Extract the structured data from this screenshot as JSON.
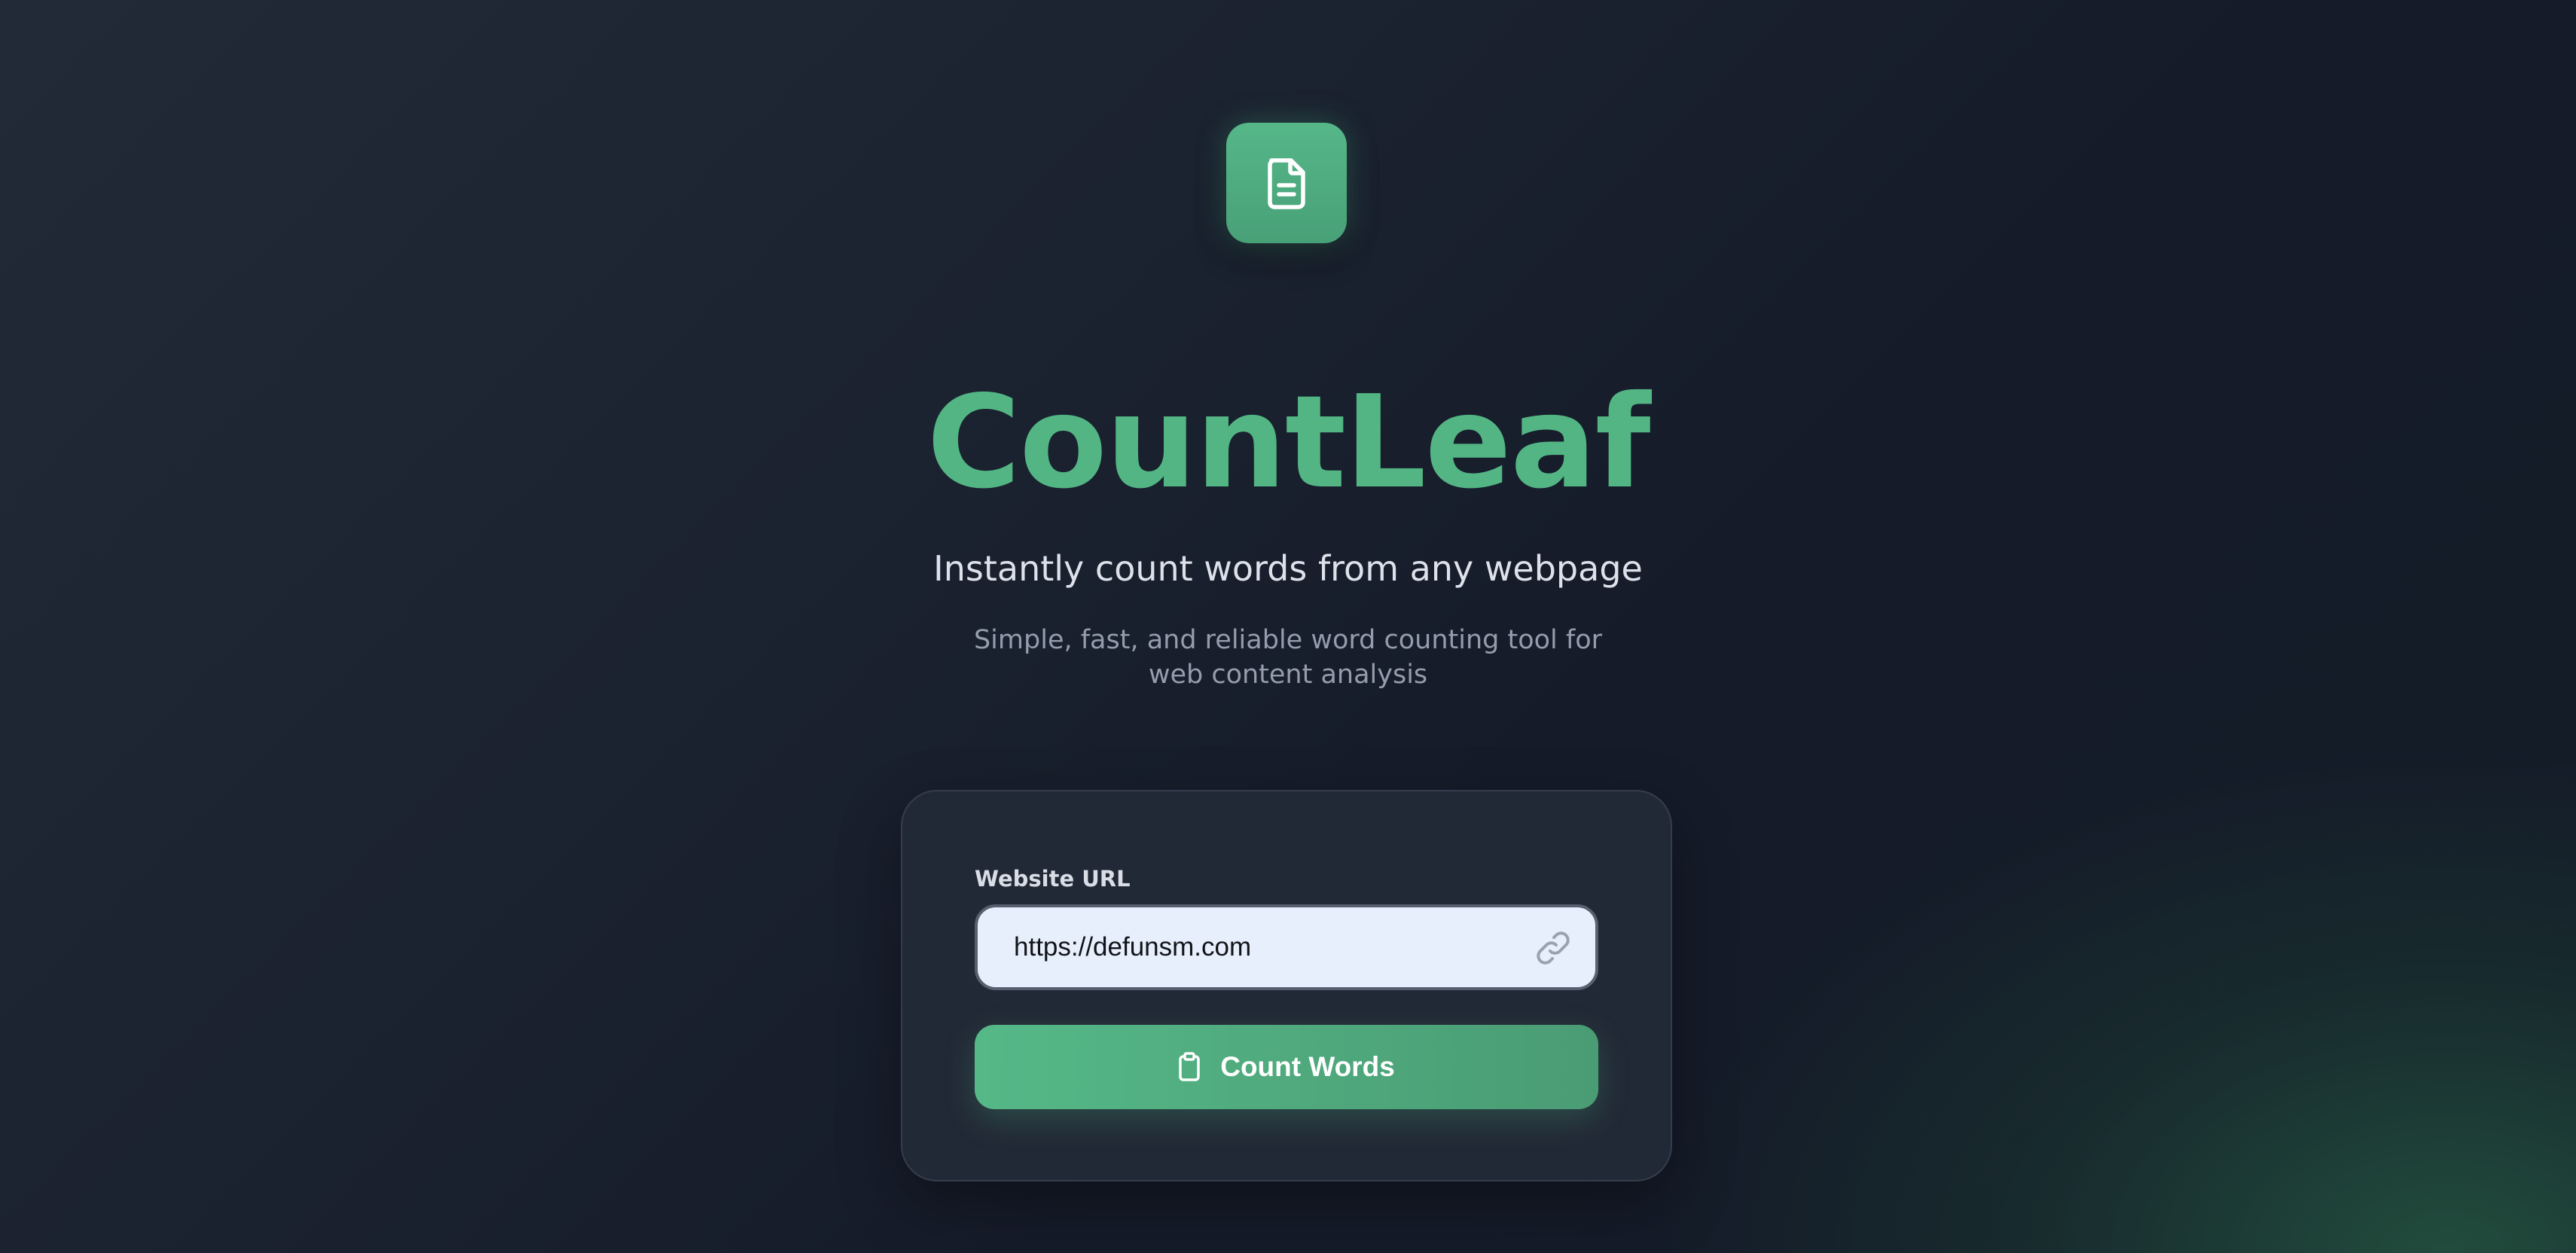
{
  "app": {
    "logo_icon": "document-icon",
    "title": "CountLeaf",
    "tagline": "Instantly count words from any webpage",
    "description": "Simple, fast, and reliable word counting tool for web content analysis"
  },
  "form": {
    "url_label": "Website URL",
    "url_value": "https://defunsm.com",
    "url_icon": "link-icon",
    "submit_label": "Count Words",
    "submit_icon": "clipboard-icon"
  },
  "colors": {
    "accent": "#52b583",
    "background": "#1b2230",
    "input_background": "#e8effc"
  }
}
